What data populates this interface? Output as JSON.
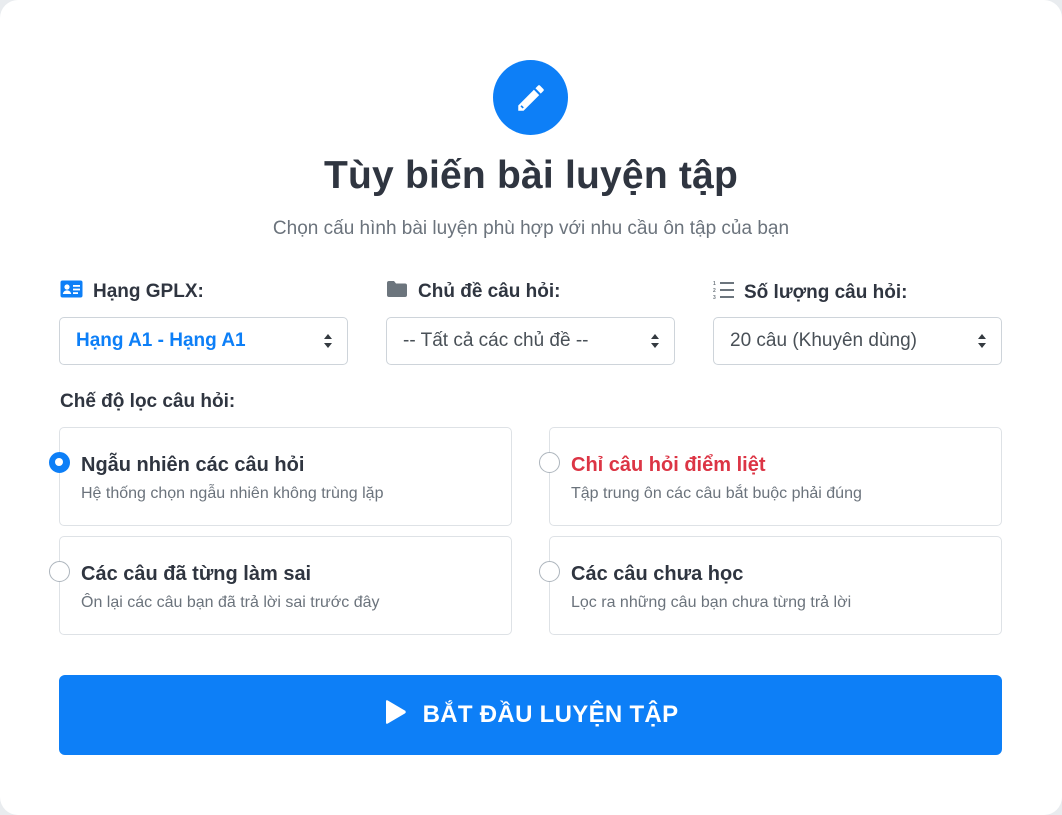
{
  "header": {
    "icon": "pencil-icon",
    "title": "Tùy biến bài luyện tập",
    "subtitle": "Chọn cấu hình bài luyện phù hợp với nhu cầu ôn tập của bạn"
  },
  "fields": {
    "license_class": {
      "icon": "id-card-icon",
      "label": "Hạng GPLX:",
      "value": "Hạng A1 - Hạng A1"
    },
    "topic": {
      "icon": "folder-icon",
      "label": "Chủ đề câu hỏi:",
      "value": "-- Tất cả các chủ đề --"
    },
    "question_count": {
      "icon": "numbered-list-icon",
      "label": "Số lượng câu hỏi:",
      "value": "20 câu (Khuyên dùng)"
    }
  },
  "filter_mode": {
    "label": "Chế độ lọc câu hỏi:",
    "options": [
      {
        "title": "Ngẫu nhiên các câu hỏi",
        "description": "Hệ thống chọn ngẫu nhiên không trùng lặp",
        "checked": true
      },
      {
        "title": "Chỉ câu hỏi điểm liệt",
        "description": "Tập trung ôn các câu bắt buộc phải đúng",
        "checked": false,
        "emphasis": "danger"
      },
      {
        "title": "Các câu đã từng làm sai",
        "description": "Ôn lại các câu bạn đã trả lời sai trước đây",
        "checked": false
      },
      {
        "title": "Các câu chưa học",
        "description": "Lọc ra những câu bạn chưa từng trả lời",
        "checked": false
      }
    ]
  },
  "start_button": {
    "icon": "play-icon",
    "label": "BẮT ĐẦU LUYỆN TẬP"
  },
  "colors": {
    "primary": "#0d7ff7",
    "danger": "#dc3545",
    "text": "#2f3540",
    "muted": "#6b737c"
  }
}
